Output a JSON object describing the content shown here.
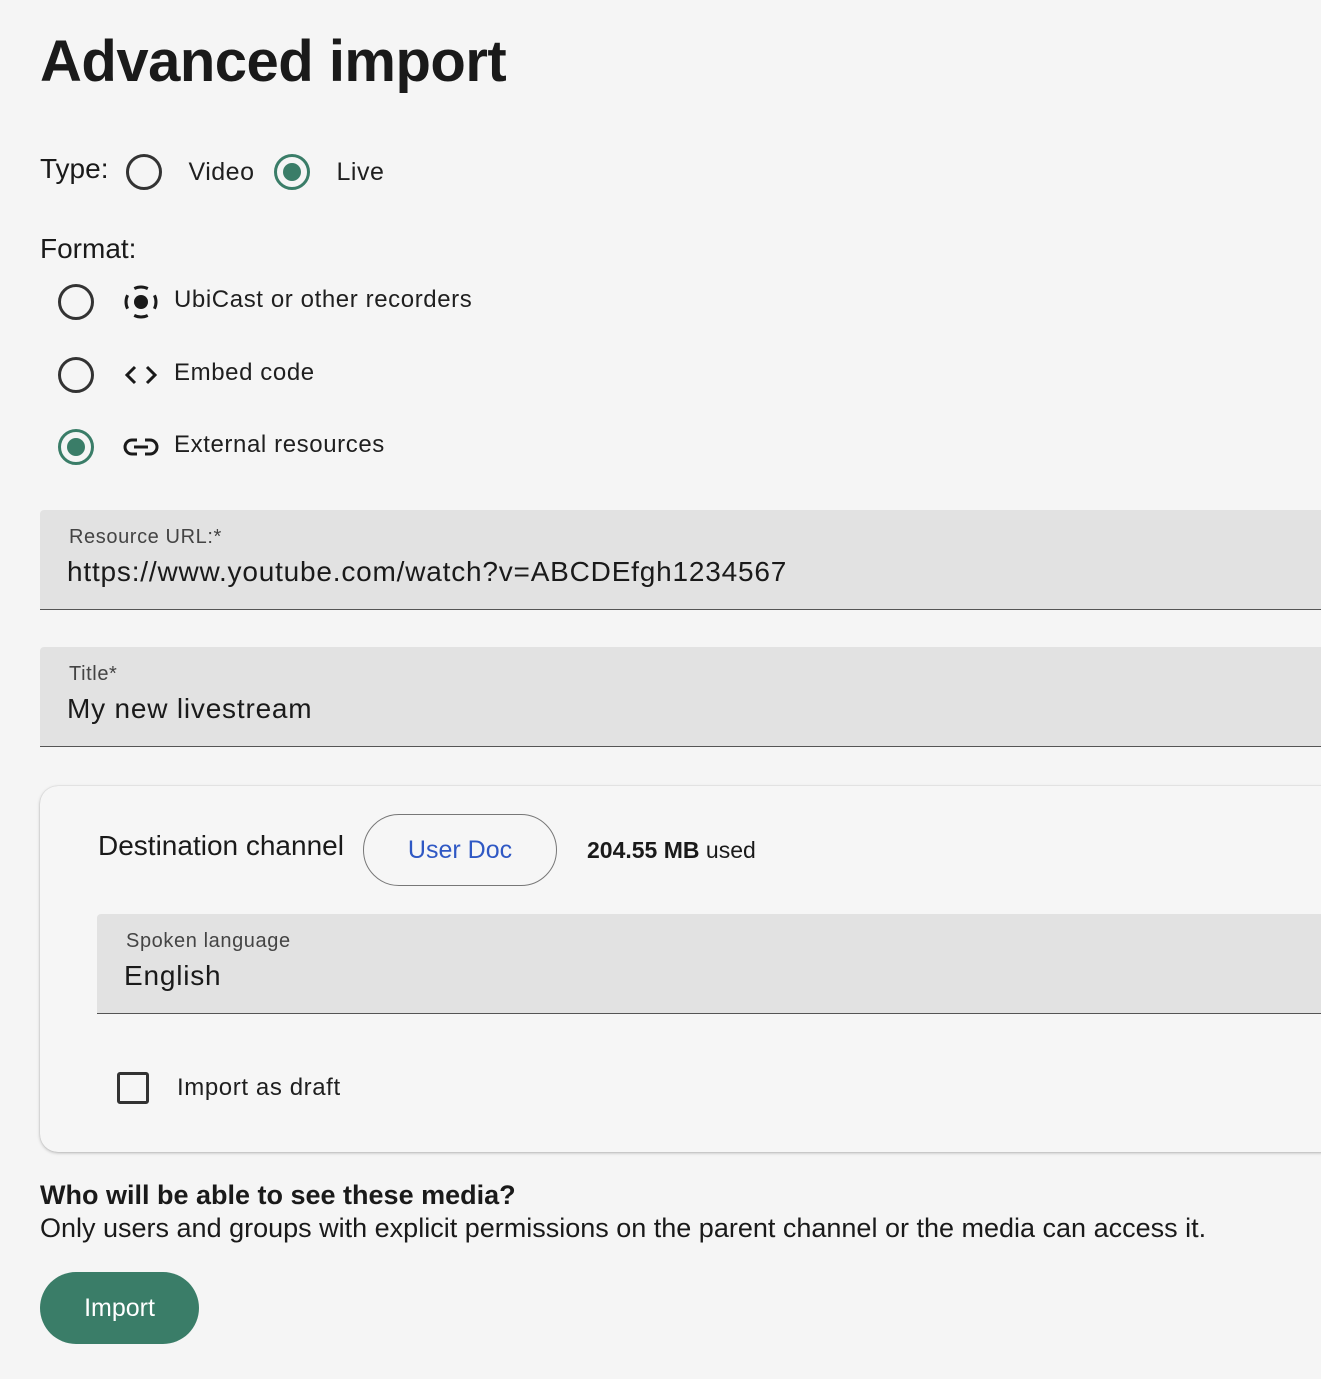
{
  "page": {
    "title": "Advanced import"
  },
  "type": {
    "label": "Type:",
    "options": [
      {
        "label": "Video",
        "checked": false
      },
      {
        "label": "Live",
        "checked": true
      }
    ]
  },
  "format": {
    "label": "Format:",
    "options": [
      {
        "label": "UbiCast or other recorders",
        "icon": "live-stream-icon",
        "checked": false
      },
      {
        "label": "Embed code",
        "icon": "code-icon",
        "checked": false
      },
      {
        "label": "External resources",
        "icon": "link-icon",
        "checked": true
      }
    ]
  },
  "resource_url": {
    "label": "Resource URL:*",
    "value": "https://www.youtube.com/watch?v=ABCDEfgh1234567"
  },
  "title_field": {
    "label": "Title*",
    "value": "My new livestream"
  },
  "destination": {
    "label": "Destination channel",
    "channel_name": "User Doc",
    "quota_value": "204.55 MB",
    "quota_suffix": " used"
  },
  "spoken_language": {
    "label": "Spoken language",
    "value": "English"
  },
  "draft": {
    "label": "Import as draft",
    "checked": false
  },
  "visibility": {
    "title": "Who will be able to see these media?",
    "text": "Only users and groups with explicit permissions on the parent channel or the media can access it."
  },
  "actions": {
    "import_label": "Import"
  },
  "colors": {
    "accent": "#3a7d68",
    "link": "#2f58c4",
    "background": "#f5f5f5",
    "field_background": "#e2e2e2"
  }
}
